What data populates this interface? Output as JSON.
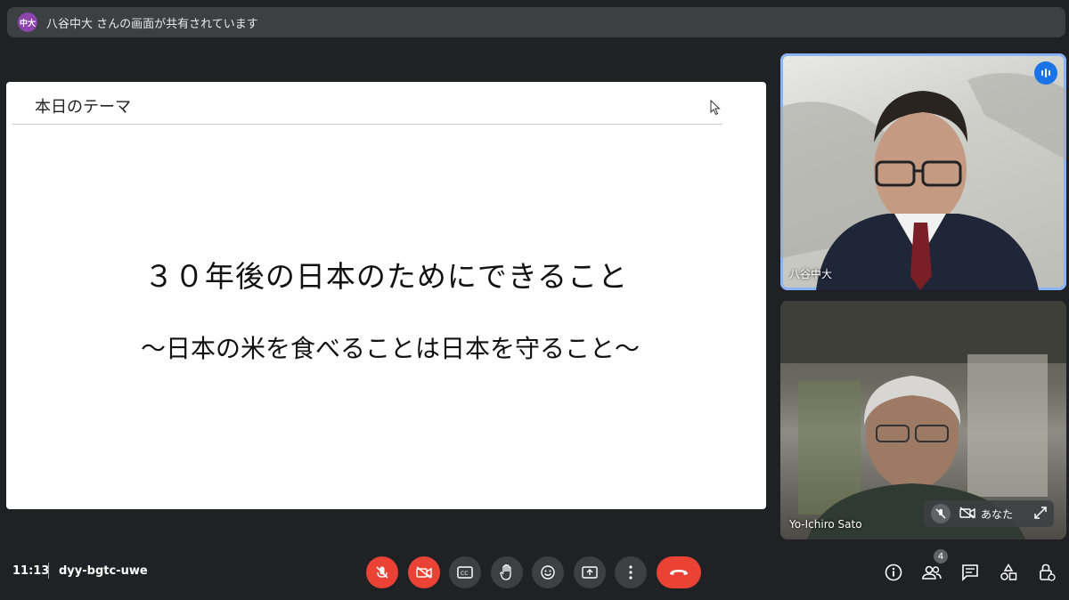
{
  "banner": {
    "avatar_text": "中大",
    "message": "八谷中大 さんの画面が共有されています"
  },
  "slide": {
    "header": "本日のテーマ",
    "title": "３０年後の日本のためにできること",
    "subtitle": "～日本の米を食べることは日本を守ること～"
  },
  "participants": [
    {
      "name": "八谷中大",
      "speaking": true
    },
    {
      "name": "Yo-Ichiro Sato",
      "self_label": "あなた"
    }
  ],
  "footer": {
    "time": "11:13",
    "meeting_code": "dyy-bgtc-uwe",
    "participant_count": "4"
  },
  "colors": {
    "danger": "#ea4335",
    "control_bg": "#3c4043",
    "speaking_accent": "#1a73e8",
    "background": "#202124"
  },
  "icons": {
    "mic": "mic-off-icon",
    "camera": "camera-off-icon",
    "captions": "captions-icon",
    "hand": "raise-hand-icon",
    "emoji": "emoji-icon",
    "present": "present-icon",
    "more": "more-vert-icon",
    "hangup": "hangup-icon",
    "info": "info-icon",
    "people": "people-icon",
    "chat": "chat-icon",
    "activities": "activities-icon",
    "host": "host-controls-icon"
  }
}
